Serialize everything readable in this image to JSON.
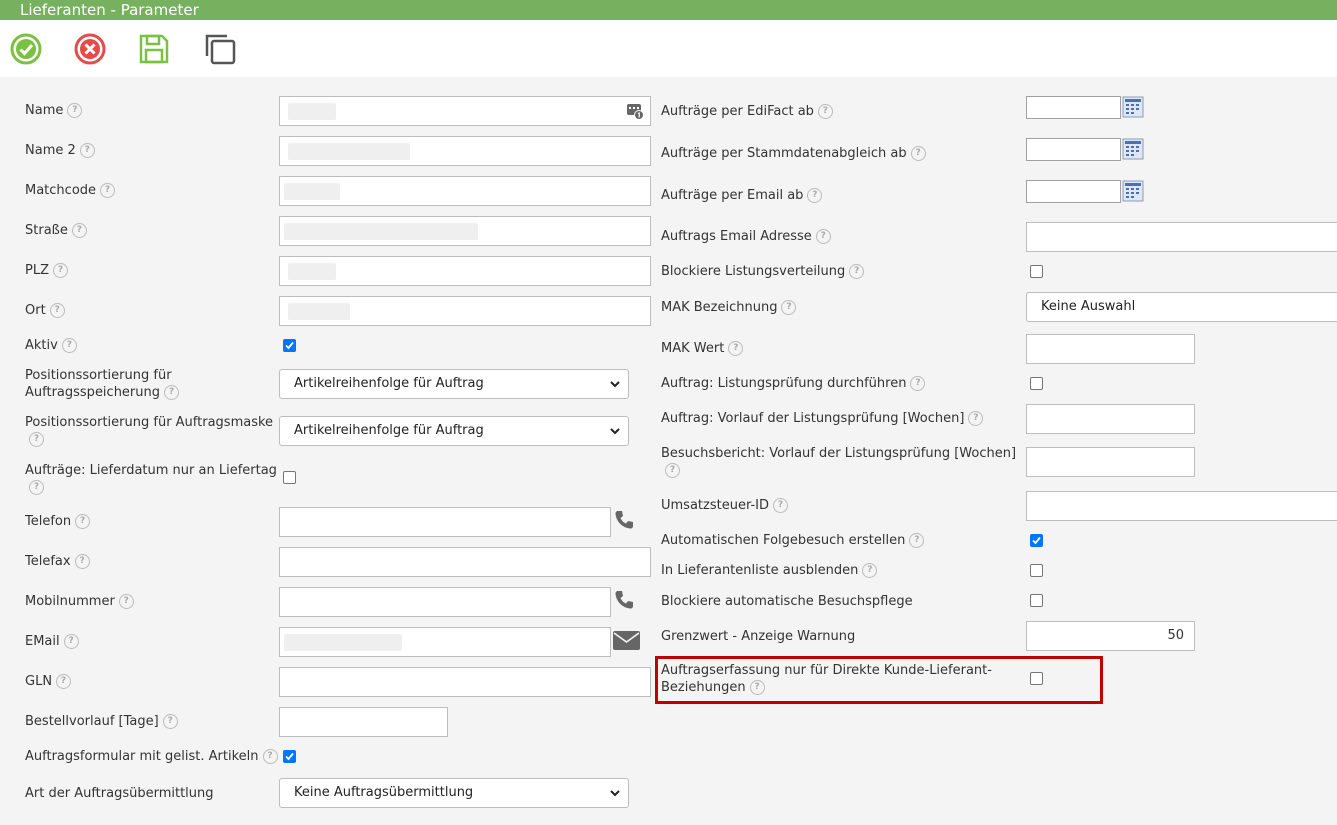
{
  "window": {
    "title": "Lieferanten - Parameter"
  },
  "toolbar": {
    "ok_icon": "check-circle-icon",
    "cancel_icon": "cancel-circle-icon",
    "save_icon": "floppy-disk-icon",
    "copy_icon": "copy-icon"
  },
  "help_glyph": "?",
  "left": {
    "name": "Name",
    "name2": "Name 2",
    "matchcode": "Matchcode",
    "strasse": "Straße",
    "plz": "PLZ",
    "ort": "Ort",
    "aktiv": "Aktiv",
    "pos_speicherung_1": "Positionssortierung für",
    "pos_speicherung_2": "Auftragsspeicherung",
    "pos_speicherung_value": "Artikelreihenfolge für Auftrag",
    "pos_maske": "Positionssortierung für Auftragsmaske",
    "pos_maske_value": "Artikelreihenfolge für Auftrag",
    "lieferdatum": "Aufträge: Lieferdatum nur an Liefertag",
    "telefon": "Telefon",
    "telefax": "Telefax",
    "mobil": "Mobilnummer",
    "email": "EMail",
    "gln": "GLN",
    "bestellvorlauf": "Bestellvorlauf [Tage]",
    "auftragsformular": "Auftragsformular mit gelist. Artikeln",
    "uebermittlung": "Art der Auftragsübermittlung",
    "uebermittlung_value": "Keine Auftragsübermittlung"
  },
  "right": {
    "edifact": "Aufträge per EdiFact ab",
    "stammdaten": "Aufträge per Stammdatenabgleich ab",
    "email_ab": "Aufträge per Email ab",
    "email_adresse": "Auftrags Email Adresse",
    "blockiere_listung": "Blockiere Listungsverteilung",
    "mak_bez": "MAK Bezeichnung",
    "mak_bez_value": "Keine Auswahl",
    "mak_wert": "MAK Wert",
    "listungspruefung": "Auftrag: Listungsprüfung durchführen",
    "vorlauf_listung": "Auftrag: Vorlauf der Listungsprüfung [Wochen]",
    "besuchsbericht": "Besuchsbericht: Vorlauf der Listungsprüfung [Wochen]",
    "ust_id": "Umsatzsteuer-ID",
    "folgebesuch": "Automatischen Folgebesuch erstellen",
    "ausblenden": "In Lieferantenliste ausblenden",
    "besuchspflege": "Blockiere automatische Besuchspflege",
    "grenzwert": "Grenzwert - Anzeige Warnung",
    "grenzwert_value": "50",
    "direkte_1": "Auftragserfassung nur für Direkte Kunde-Lieferant-",
    "direkte_2": "Beziehungen"
  },
  "checkboxes": {
    "aktiv": true,
    "lieferdatum": false,
    "auftragsformular": true,
    "blockiere_listung": false,
    "listungspruefung": false,
    "folgebesuch": true,
    "ausblenden": false,
    "besuchspflege": false,
    "direkte": false
  },
  "colors": {
    "titlebar": "#77b160",
    "highlight": "#c00000",
    "checkbox": "#0075ff"
  }
}
